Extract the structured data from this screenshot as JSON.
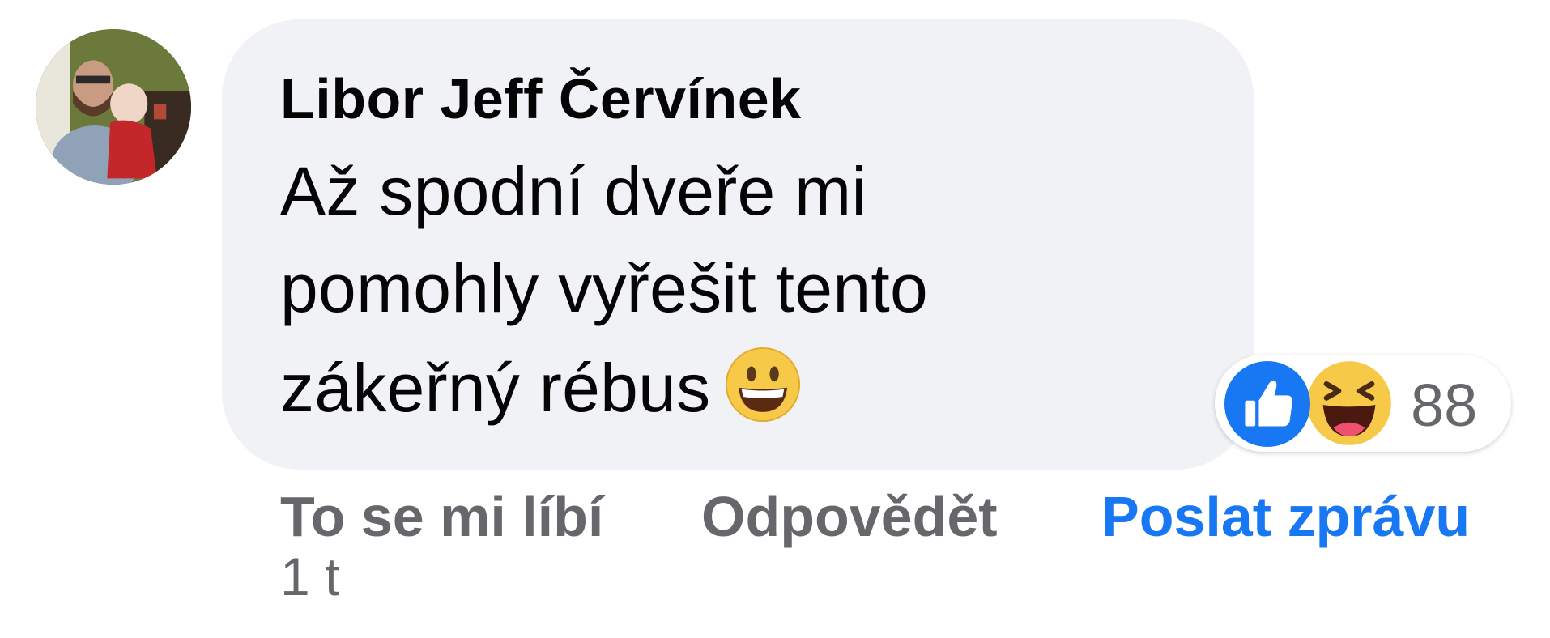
{
  "comment": {
    "author": "Libor Jeff Červínek",
    "lines": [
      "Až spodní dveře mi",
      "pomohly vyřešit tento",
      "zákeřný rébus"
    ],
    "inline_emoji": "grinning-face-emoji"
  },
  "reactions": {
    "icons": [
      "like-icon",
      "haha-icon"
    ],
    "count": "88"
  },
  "actions": {
    "like": "To se mi líbí",
    "reply": "Odpovědět",
    "send_message": "Poslat zprávu"
  },
  "timestamp": "1 t",
  "colors": {
    "bubble": "#f0f2f5",
    "link_blue": "#1877f2",
    "secondary_text": "#65676b",
    "primary_text": "#050505"
  }
}
